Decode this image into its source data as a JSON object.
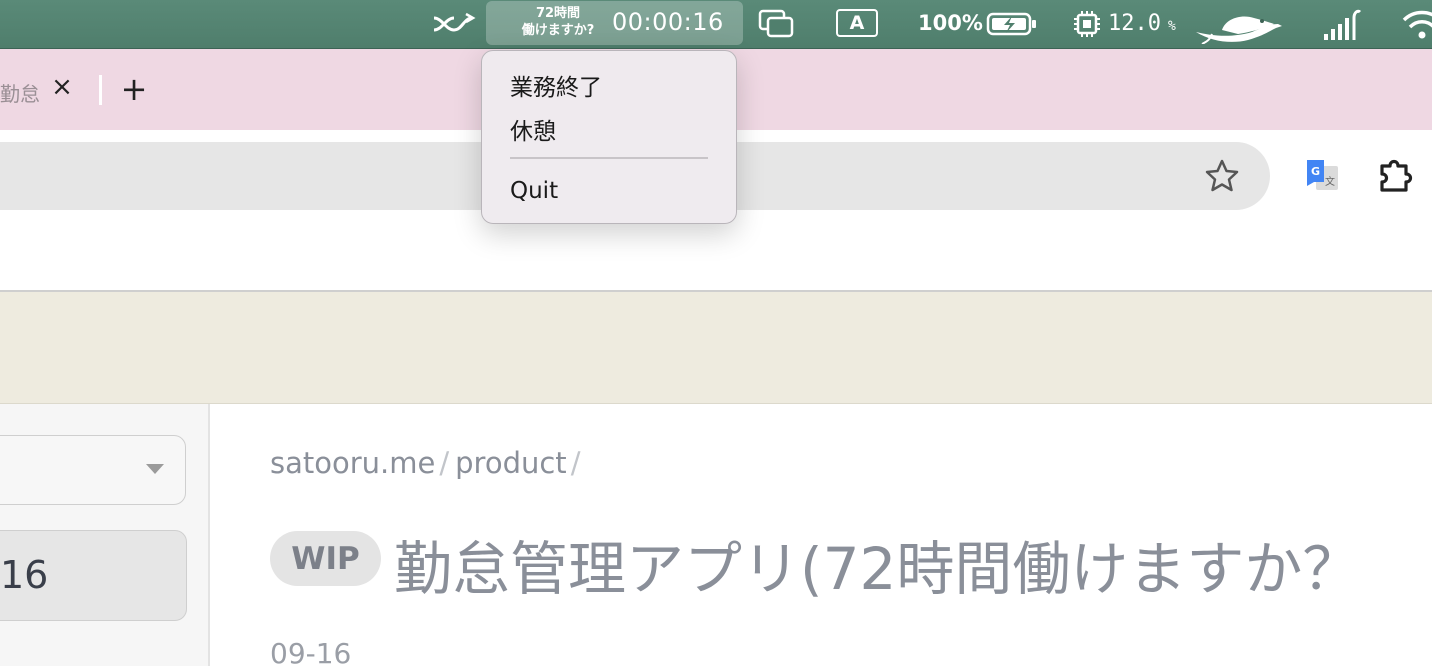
{
  "menubar": {
    "app_name_line1": "72時間",
    "app_name_line2": "働けますか?",
    "timer": "00:00:16",
    "input_mode": "A",
    "battery_percent": "100%",
    "cpu_value": "12.0",
    "cpu_unit": "%",
    "background_color": "#5a8a78"
  },
  "app_menu": {
    "items": [
      "業務終了",
      "休憩",
      "Quit"
    ]
  },
  "browser": {
    "tab_title": "勤怠",
    "tab_close": "×",
    "new_tab": "+"
  },
  "page": {
    "breadcrumb": [
      "satooru.me",
      "product"
    ],
    "breadcrumb_separator": "/",
    "badge": "WIP",
    "title": "勤怠管理アプリ(72時間働けますか？",
    "sidebar_date": "16",
    "date": "09-16"
  },
  "icons": [
    "shuffle-icon",
    "window-switcher-icon",
    "battery-charging-icon",
    "cpu-icon",
    "penguin-icon",
    "signal-icon",
    "wifi-icon",
    "star-icon",
    "translate-icon",
    "extensions-icon",
    "dropdown-caret-icon"
  ]
}
